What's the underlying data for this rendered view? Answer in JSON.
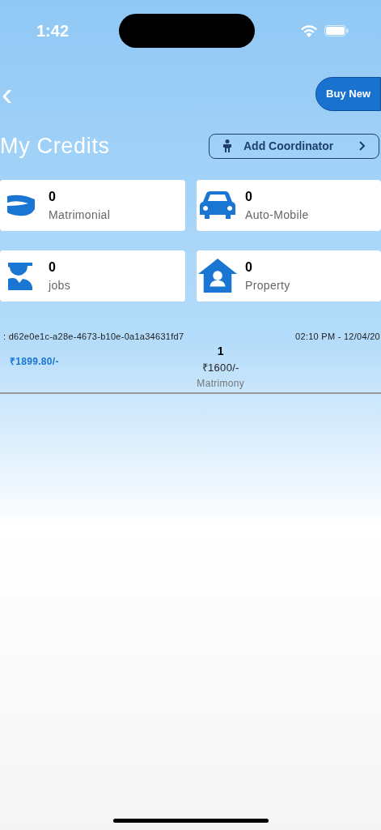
{
  "status_bar": {
    "time": "1:42"
  },
  "header": {
    "back": "‹",
    "buy_button": "Buy New"
  },
  "title": "My Credits",
  "add_coordinator": {
    "label": "Add Coordinator"
  },
  "credits": [
    {
      "kind": "ring",
      "count": "0",
      "label": "Matrimonial"
    },
    {
      "kind": "car",
      "count": "0",
      "label": "Auto-Mobile"
    },
    {
      "kind": "graduate",
      "count": "0",
      "label": "jobs"
    },
    {
      "kind": "house",
      "count": "0",
      "label": "Property"
    }
  ],
  "transactions": [
    {
      "id": ": d62e0e1c-a28e-4673-b10e-0a1a34631fd7",
      "time": "02:10 PM - 12/04/20",
      "total": "₹1899.80/-",
      "quantity": "1",
      "price": "₹1600/-",
      "category": "Matrimony"
    }
  ]
}
